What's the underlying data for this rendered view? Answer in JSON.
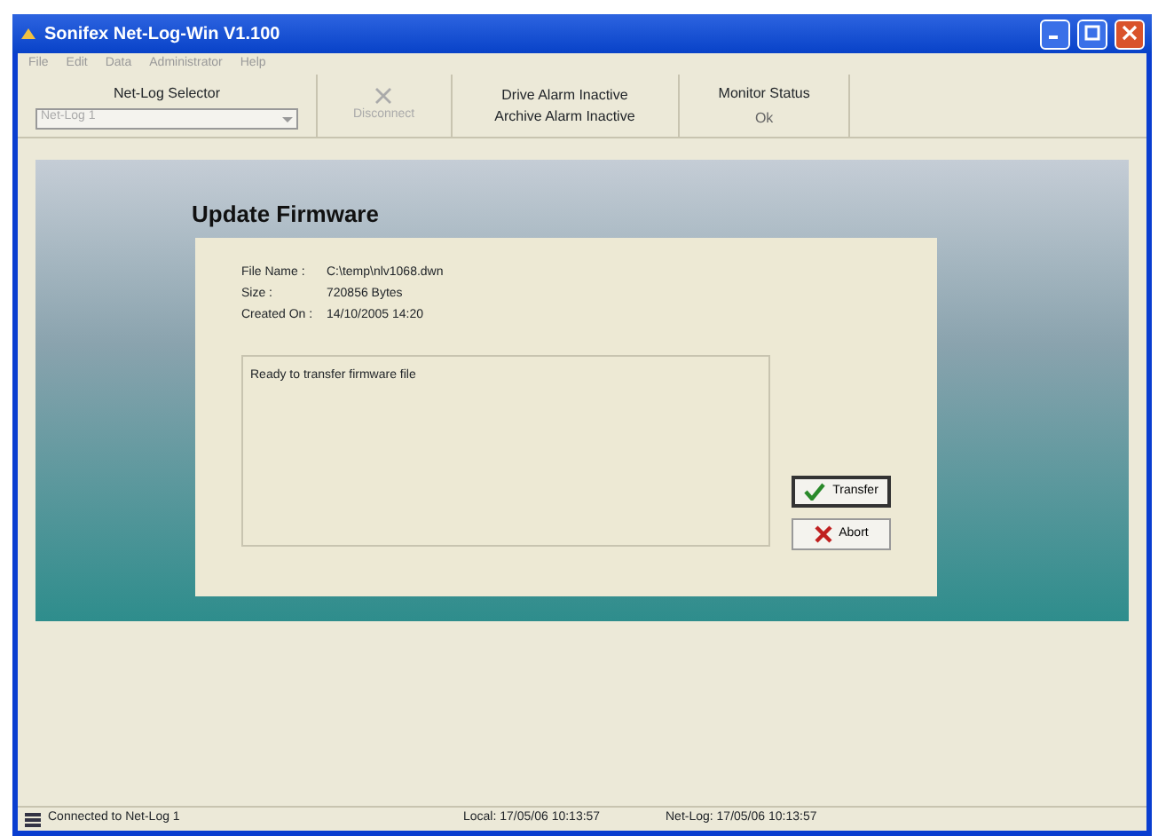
{
  "window": {
    "title": "Sonifex Net-Log-Win V1.100"
  },
  "menu": [
    {
      "label": "File",
      "disabled": true
    },
    {
      "label": "Edit",
      "disabled": true
    },
    {
      "label": "Data",
      "disabled": true
    },
    {
      "label": "Administrator",
      "disabled": true
    },
    {
      "label": "Help",
      "disabled": true
    }
  ],
  "toolbar": {
    "selector_label": "Net-Log Selector",
    "selector_value": "Net-Log 1",
    "selector_disabled": true,
    "disconnect": {
      "label": "Disconnect",
      "disabled": true
    },
    "alarms": [
      "Drive Alarm Inactive",
      "Archive Alarm Inactive"
    ],
    "monitor_label": "Monitor Status",
    "monitor_value": "Ok"
  },
  "panel": {
    "title": "Update Firmware",
    "fields": [
      {
        "label": "File Name :",
        "value": "C:\\temp\\nlv1068.dwn"
      },
      {
        "label": "Size :",
        "value": "720856 Bytes"
      },
      {
        "label": "Created On :",
        "value": "14/10/2005 14:20"
      }
    ],
    "log": "Ready to transfer firmware file",
    "buttons": [
      {
        "kind": "transfer",
        "label": "Transfer",
        "selected": true
      },
      {
        "kind": "abort",
        "label": "Abort",
        "selected": false
      }
    ]
  },
  "status_bar": {
    "connection": "Connected to Net-Log 1",
    "local": "Local: 17/05/06 10:13:57",
    "netlog": "Net-Log: 17/05/06 10:13:57"
  }
}
